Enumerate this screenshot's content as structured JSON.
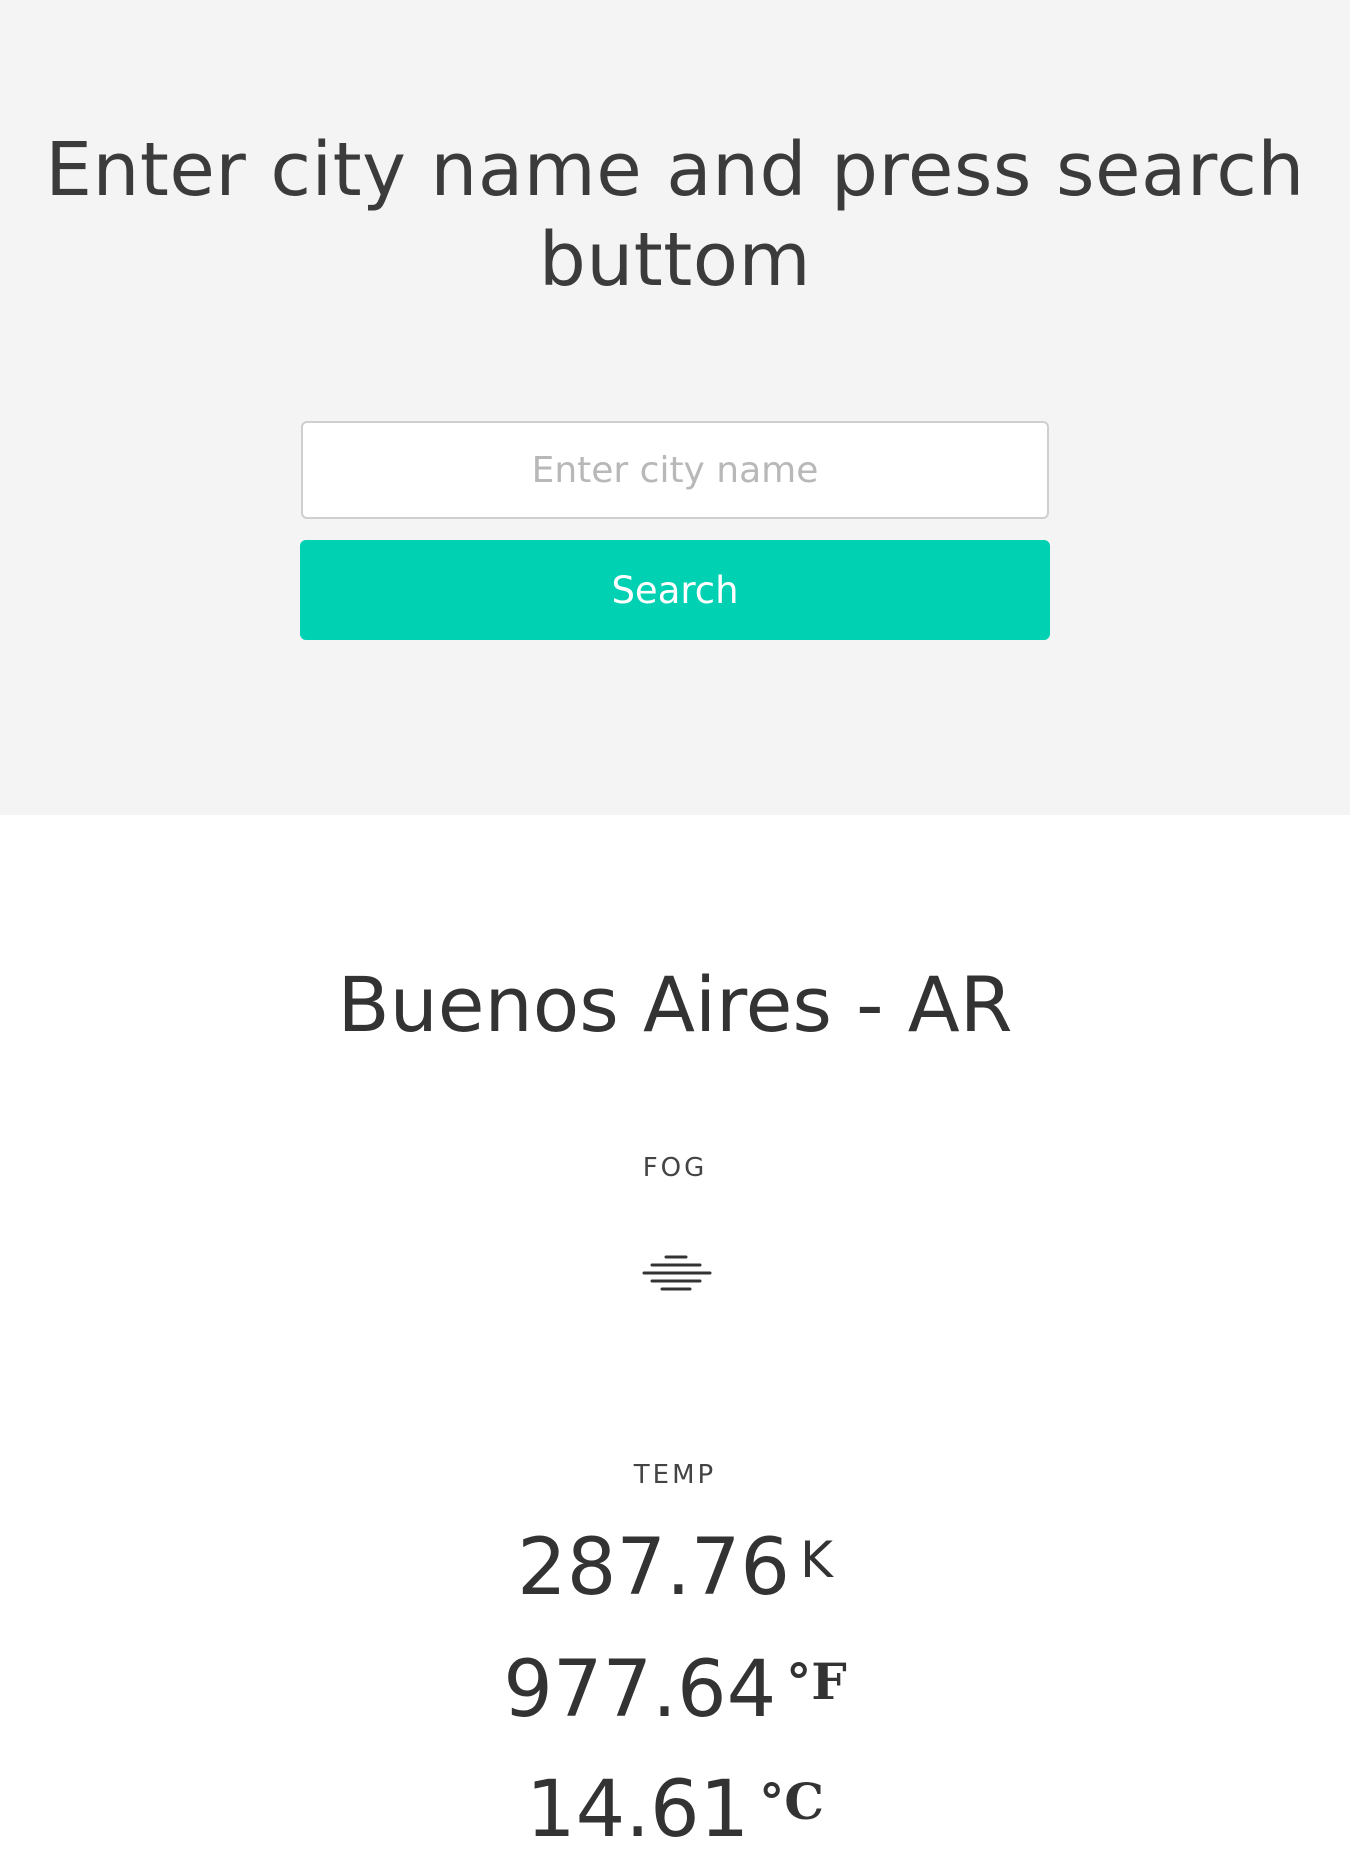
{
  "header": {
    "title": "Enter city name and press search buttom"
  },
  "search": {
    "placeholder": "Enter city name",
    "value": "",
    "button_label": "Search"
  },
  "result": {
    "city": "Buenos Aires - AR",
    "description": "FOG",
    "icon": "fog-icon",
    "temp_label": "TEMP",
    "temps": [
      {
        "value": "287.76",
        "unit": "K"
      },
      {
        "value": "977.64",
        "unit": "°F"
      },
      {
        "value": "14.61",
        "unit": "°C"
      }
    ]
  },
  "colors": {
    "accent": "#00d1b2",
    "hero_background": "#f4f4f5",
    "text": "#333333"
  }
}
